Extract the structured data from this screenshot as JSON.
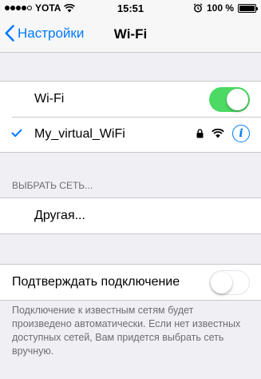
{
  "status_bar": {
    "carrier": "YOTA",
    "time": "15:51",
    "battery_percent": "100 %",
    "signal_bars_filled": 4,
    "signal_bars_total": 5
  },
  "nav": {
    "back_label": "Настройки",
    "title": "Wi-Fi"
  },
  "wifi": {
    "label": "Wi-Fi",
    "enabled": true
  },
  "connected_network": {
    "name": "My_virtual_WiFi",
    "secured": true,
    "icons": [
      "checkmark-icon",
      "lock-icon",
      "wifi-signal-icon",
      "info-icon"
    ]
  },
  "choose_network": {
    "header": "ВЫБРАТЬ СЕТЬ...",
    "other_label": "Другая..."
  },
  "ask_to_join": {
    "label": "Подтверждать подключение",
    "enabled": false,
    "footer": "Подключение к известным сетям будет произведено автоматически. Если нет известных доступных сетей, Вам придется выбрать сеть вручную."
  },
  "colors": {
    "accent": "#007aff",
    "toggle_on": "#4cd964",
    "background": "#efeff4",
    "separator": "#c8c7cc",
    "secondary_text": "#6d6d72"
  }
}
